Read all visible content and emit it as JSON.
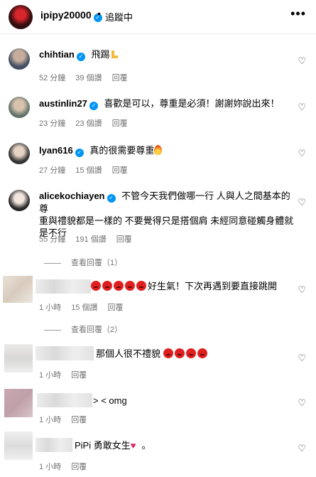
{
  "header": {
    "username": "ipipy20000",
    "separator": "•",
    "follow_status": "追蹤中",
    "more": "•••"
  },
  "comments": [
    {
      "username": "chihtian",
      "text": "飛踢",
      "time": "52 分鐘",
      "likes": "39 個讚",
      "reply": "回覆",
      "verified": true
    },
    {
      "username": "austinlin27",
      "text": "喜歡是可以，尊重是必須！謝謝妳說出來！",
      "time": "23 分鐘",
      "likes": "23 個讚",
      "reply": "回覆",
      "verified": true
    },
    {
      "username": "lyan616",
      "text": "真的很需要尊重",
      "time": "27 分鐘",
      "likes": "15 個讚",
      "reply": "回覆",
      "verified": true
    },
    {
      "username": "alicekochiayen",
      "text_line1": "不管今天我們做哪一行 人與人之間基本的尊",
      "text_line2": "重與禮貌都是一樣的 不要覺得只是搭個肩 未經同意碰觸身體就",
      "text_line3": "是不行",
      "time": "55 分鐘",
      "likes": "191 個讚",
      "reply": "回覆",
      "verified": true,
      "view_replies": "查看回覆（1）"
    },
    {
      "text": "好生氣！下次再遇到要直接跳開",
      "time": "1 小時",
      "likes": "15 個讚",
      "reply": "回覆",
      "view_replies": "查看回覆（2）"
    },
    {
      "text": "那個人很不禮貌",
      "time": "1 小時",
      "reply": "回覆"
    },
    {
      "text": "> < omg",
      "time": "1 小時",
      "reply": "回覆"
    },
    {
      "text": "PiPi 勇敢女生",
      "trailing": "。",
      "time": "1 小時",
      "reply": "回覆"
    }
  ],
  "icons": {
    "heart": "heart-outline-icon",
    "verified": "verified-badge-icon"
  },
  "colors": {
    "verified": "#0095f6",
    "meta": "#737373"
  }
}
